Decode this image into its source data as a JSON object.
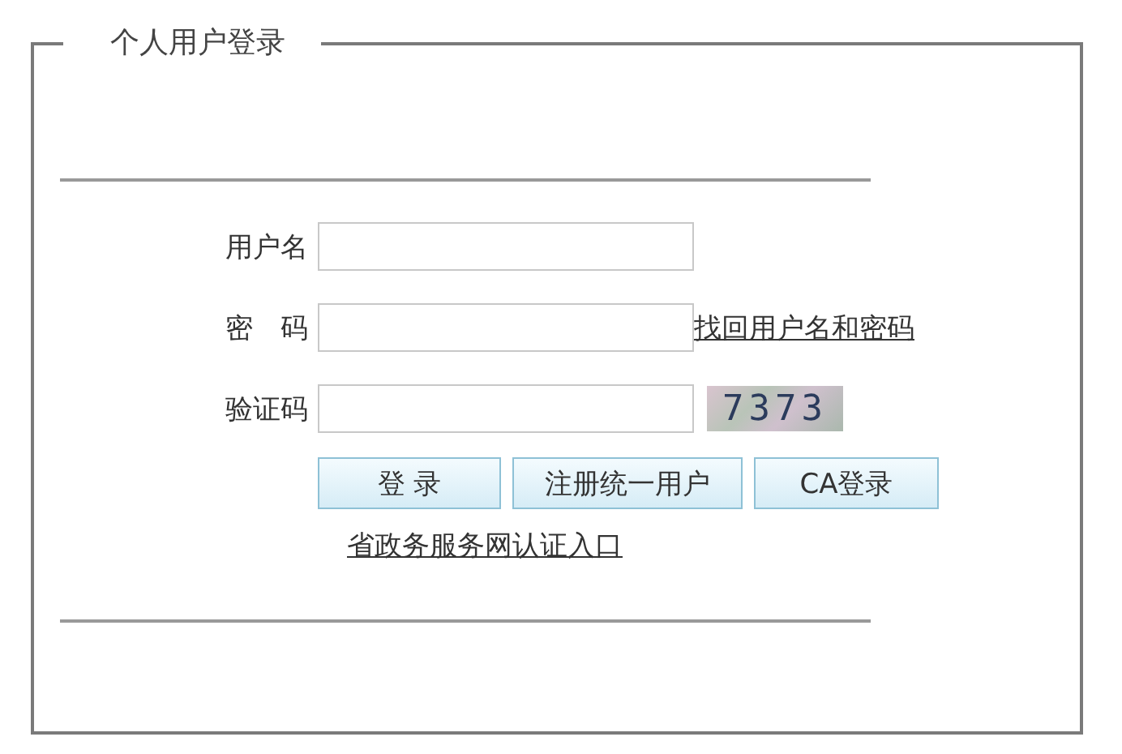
{
  "panel": {
    "title": "个人用户登录"
  },
  "fields": [
    {
      "label": "用户名",
      "kind": "text"
    },
    {
      "label": "密　码",
      "kind": "password",
      "link": "找回用户名和密码"
    },
    {
      "label": "验证码",
      "kind": "captcha",
      "captcha": "7373"
    }
  ],
  "buttons": [
    "登 录",
    "注册统一用户",
    "CA登录"
  ],
  "entry_link": "省政务服务网认证入口"
}
